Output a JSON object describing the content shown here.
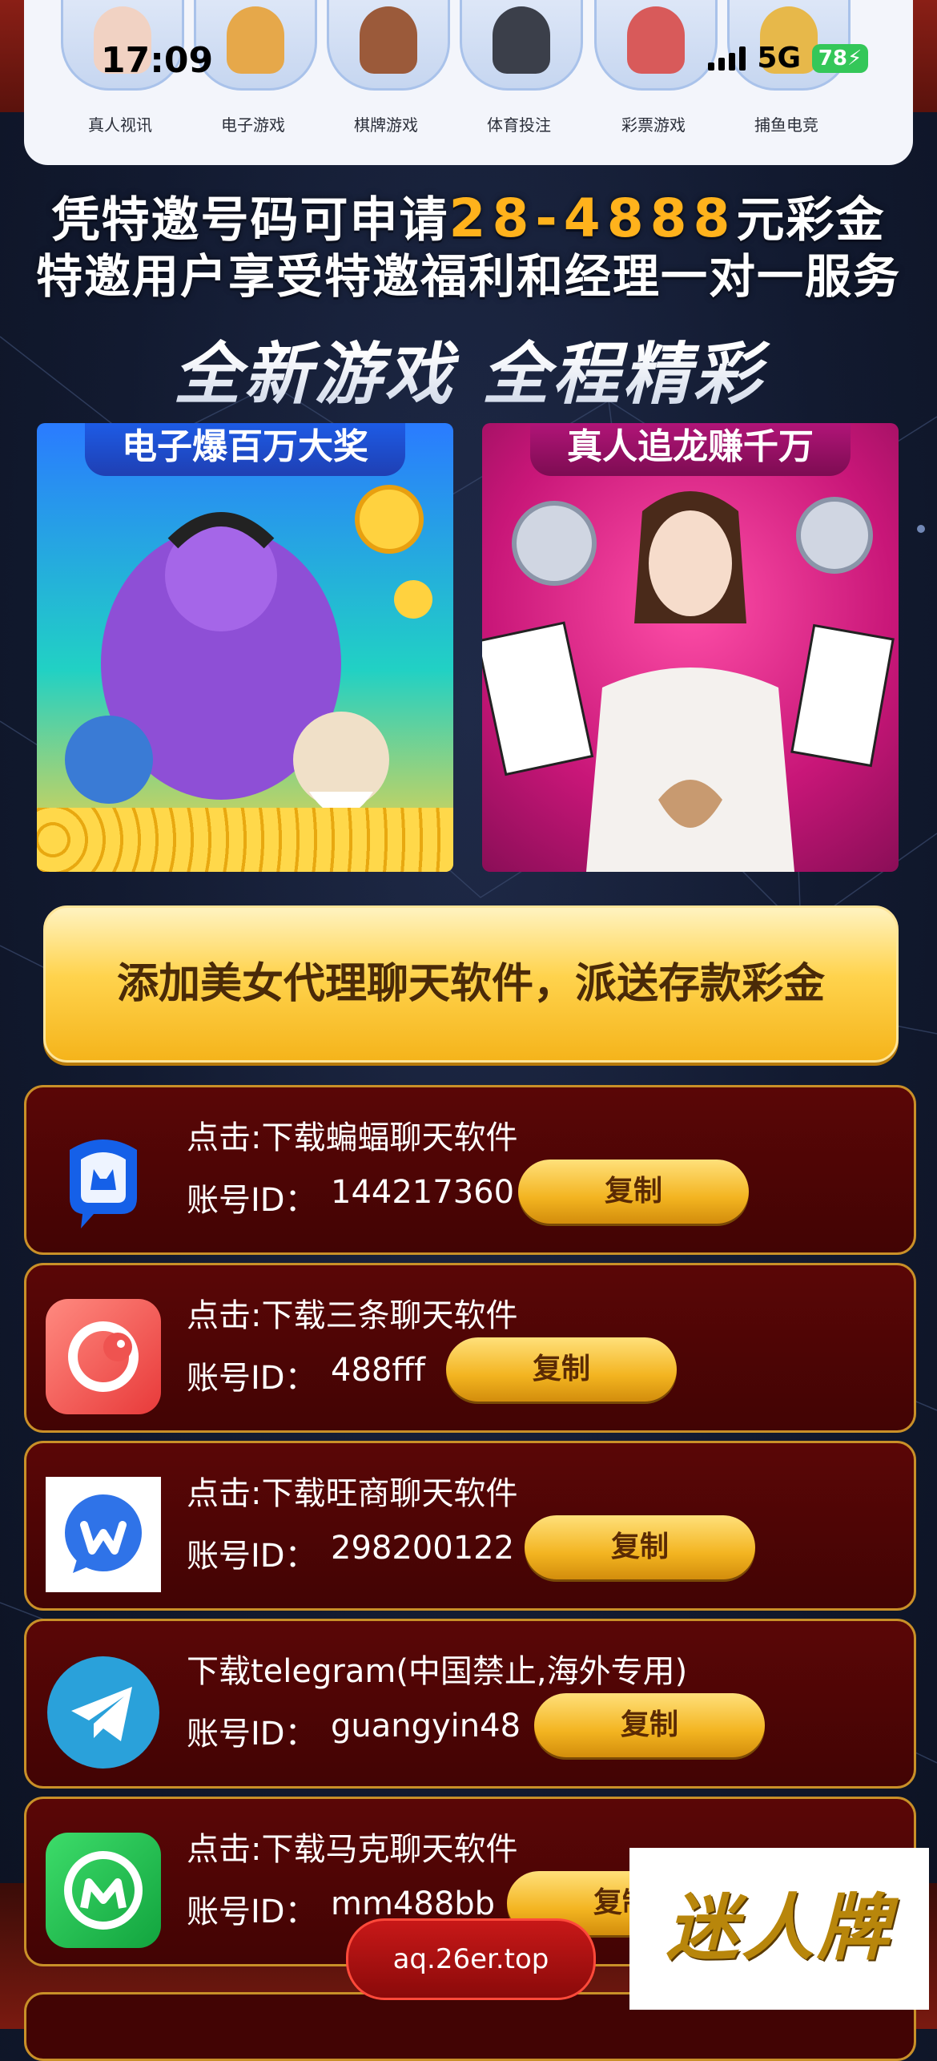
{
  "status_bar": {
    "time": "17:09",
    "network": "5G",
    "battery": "78"
  },
  "categories": [
    {
      "label": "真人视讯"
    },
    {
      "label": "电子游戏"
    },
    {
      "label": "棋牌游戏"
    },
    {
      "label": "体育投注"
    },
    {
      "label": "彩票游戏"
    },
    {
      "label": "捕鱼电竞"
    }
  ],
  "headline": {
    "line1_prefix": "凭特邀号码可申请",
    "line1_amount": "28-4888",
    "line1_suffix": "元彩金",
    "line2": "特邀用户享受特邀福利和经理一对一服务",
    "line3": "全新游戏 全程精彩"
  },
  "promos": [
    {
      "label": "电子爆百万大奖"
    },
    {
      "label": "真人追龙赚千万"
    }
  ],
  "add_agent_button": "添加美女代理聊天软件，派送存款彩金",
  "apps": [
    {
      "title": "点击:下载蝙蝠聊天软件",
      "id_label": "账号ID：",
      "id_value": "144217360",
      "copy": "复制",
      "icon": "bat-chat-icon"
    },
    {
      "title": "点击:下载三条聊天软件",
      "id_label": "账号ID：",
      "id_value": "488fff",
      "copy": "复制",
      "icon": "santiao-chat-icon"
    },
    {
      "title": "点击:下载旺商聊天软件",
      "id_label": "账号ID：",
      "id_value": "298200122",
      "copy": "复制",
      "icon": "wangshang-chat-icon"
    },
    {
      "title": "下载telegram(中国禁止,海外专用)",
      "id_label": "账号ID：",
      "id_value": "guangyin48",
      "copy": "复制",
      "icon": "telegram-icon"
    },
    {
      "title": "点击:下载马克聊天软件",
      "id_label": "账号ID：",
      "id_value": "mm488bb",
      "copy": "复制",
      "icon": "mark-chat-icon"
    }
  ],
  "url_pill": "aq.26er.top",
  "watermark": "迷人牌"
}
